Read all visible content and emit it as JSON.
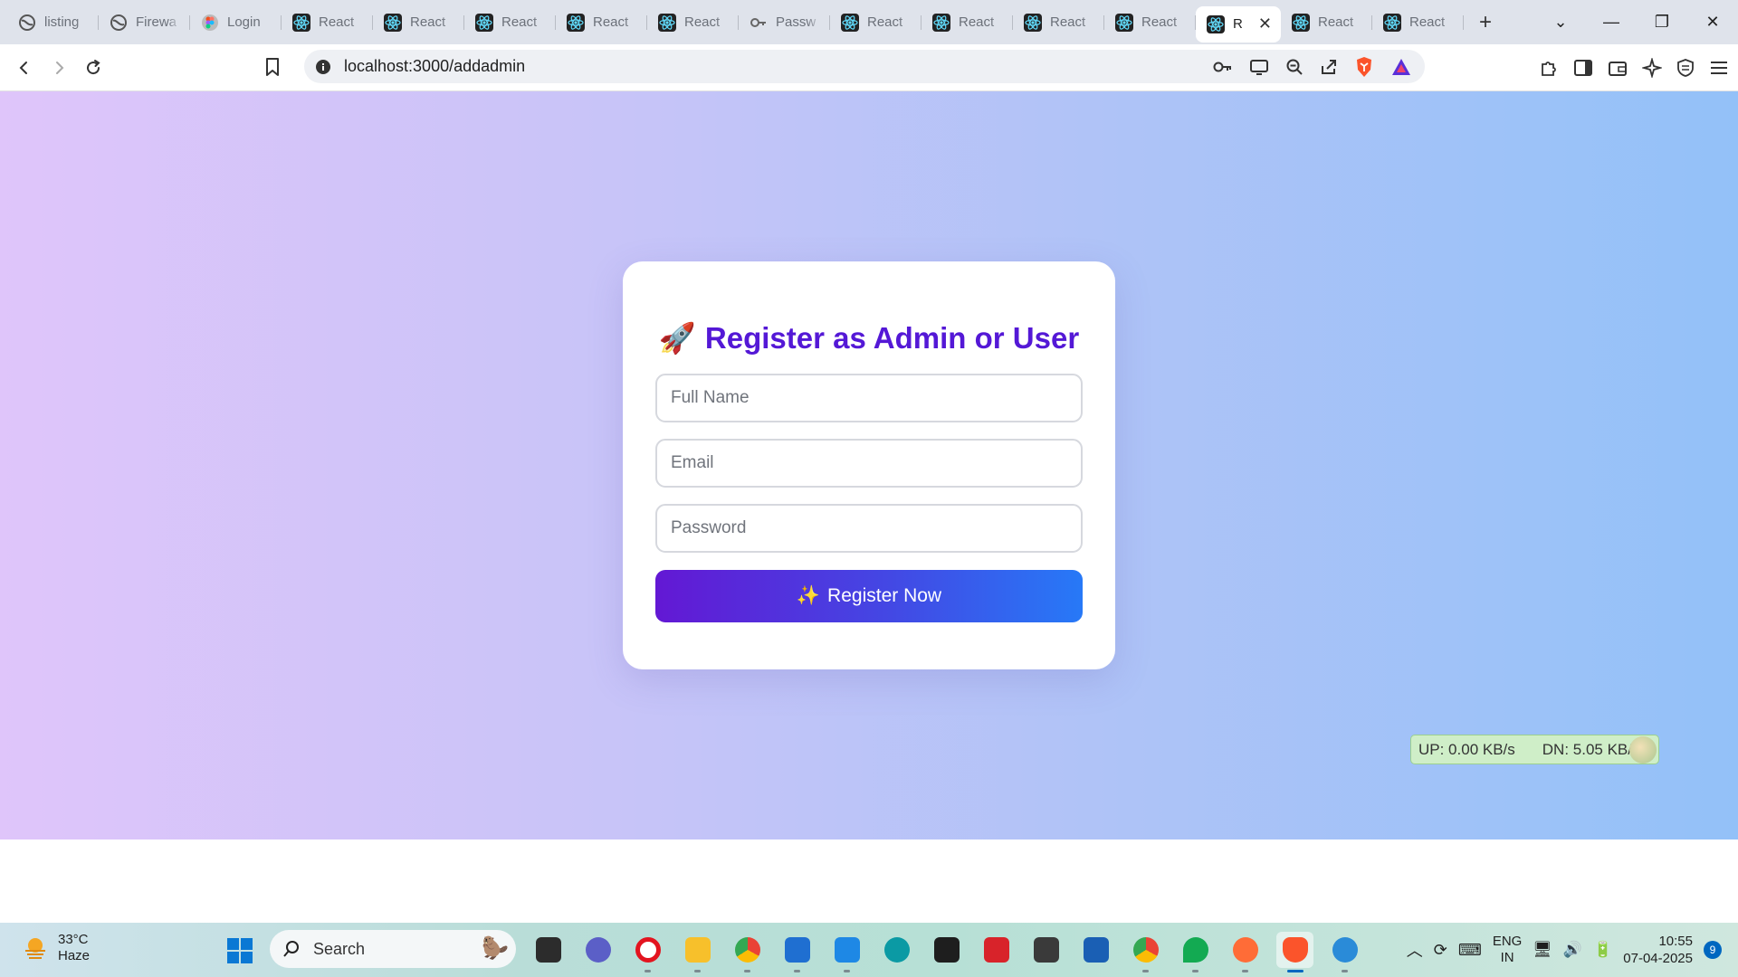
{
  "browser": {
    "tabs": [
      {
        "label": "listing",
        "icon": "globe-icon"
      },
      {
        "label": "Firewa",
        "icon": "globe-icon"
      },
      {
        "label": "Login",
        "icon": "figma-icon"
      },
      {
        "label": "React",
        "icon": "react-icon"
      },
      {
        "label": "React",
        "icon": "react-icon"
      },
      {
        "label": "React",
        "icon": "react-icon"
      },
      {
        "label": "React",
        "icon": "react-icon"
      },
      {
        "label": "React",
        "icon": "react-icon"
      },
      {
        "label": "Passw",
        "icon": "key-icon"
      },
      {
        "label": "React",
        "icon": "react-icon"
      },
      {
        "label": "React",
        "icon": "react-icon"
      },
      {
        "label": "React",
        "icon": "react-icon"
      },
      {
        "label": "React",
        "icon": "react-icon"
      },
      {
        "label": "R",
        "icon": "react-icon",
        "active": true
      },
      {
        "label": "React",
        "icon": "react-icon"
      },
      {
        "label": "React",
        "icon": "react-icon"
      }
    ],
    "url": "localhost:3000/addadmin"
  },
  "form": {
    "title_emoji": "🚀",
    "title": "Register as Admin or User",
    "name_placeholder": "Full Name",
    "email_placeholder": "Email",
    "password_placeholder": "Password",
    "submit_emoji": "✨",
    "submit_label": "Register Now"
  },
  "netspeed": {
    "up": "UP: 0.00 KB/s",
    "down": "DN: 5.05 KB/s"
  },
  "taskbar": {
    "weather_temp": "33°C",
    "weather_desc": "Haze",
    "search_label": "Search",
    "lang_top": "ENG",
    "lang_bottom": "IN",
    "time": "10:55",
    "date": "07-04-2025",
    "notification_count": "9"
  },
  "colors": {
    "accent": "#5418d6",
    "button_start": "#6318d4",
    "button_end": "#2779f7"
  }
}
